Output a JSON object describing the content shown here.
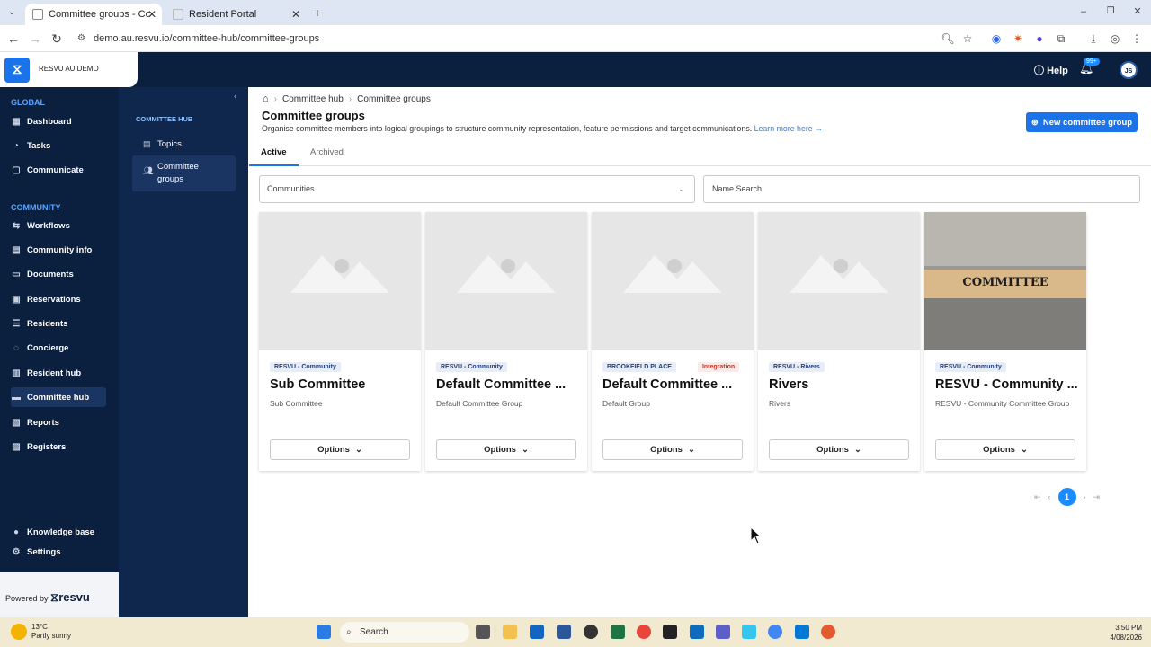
{
  "browser": {
    "tabs": [
      {
        "label": "Committee groups - Committe",
        "active": true
      },
      {
        "label": "Resident Portal",
        "active": false
      }
    ],
    "url": "demo.au.resvu.io/committee-hub/committee-groups"
  },
  "app": {
    "brand_name": "RESVU AU DEMO",
    "help_label": "Help",
    "notification_count": "99+",
    "user_initials": "JS"
  },
  "sidebar": {
    "global_label": "GLOBAL",
    "global_items": [
      {
        "label": "Dashboard",
        "icon": "dashboard-icon"
      },
      {
        "label": "Tasks",
        "icon": "tasks-icon"
      },
      {
        "label": "Communicate",
        "icon": "communicate-icon"
      }
    ],
    "community_label": "COMMUNITY",
    "community_items": [
      {
        "label": "Workflows",
        "icon": "workflows-icon"
      },
      {
        "label": "Community info",
        "icon": "info-icon"
      },
      {
        "label": "Documents",
        "icon": "documents-icon"
      },
      {
        "label": "Reservations",
        "icon": "reservations-icon"
      },
      {
        "label": "Residents",
        "icon": "residents-icon"
      },
      {
        "label": "Concierge",
        "icon": "concierge-icon"
      },
      {
        "label": "Resident hub",
        "icon": "resident-hub-icon"
      },
      {
        "label": "Committee hub",
        "icon": "committee-hub-icon",
        "active": true
      },
      {
        "label": "Reports",
        "icon": "reports-icon"
      },
      {
        "label": "Registers",
        "icon": "registers-icon"
      }
    ],
    "footer_items": [
      {
        "label": "Knowledge base",
        "icon": "knowledge-base-icon"
      },
      {
        "label": "Settings",
        "icon": "settings-icon"
      }
    ],
    "powered_by": "Powered by",
    "powered_brand": "resvu"
  },
  "subnav": {
    "section": "COMMITTEE HUB",
    "items": [
      {
        "label": "Topics",
        "icon": "topics-icon"
      },
      {
        "label": "Committee groups",
        "icon": "groups-icon",
        "active": true
      }
    ]
  },
  "page": {
    "breadcrumb": [
      "Committee hub",
      "Committee groups"
    ],
    "title": "Committee groups",
    "subtitle": "Organise committee members into logical groupings to structure community representation, feature permissions and target communications.",
    "learn_more": "Learn more here →",
    "new_button": "New committee group",
    "tabs": [
      "Active",
      "Archived"
    ],
    "communities_placeholder": "Communities",
    "search_placeholder": "Name Search"
  },
  "cards": [
    {
      "tags": [
        "RESVU - Community"
      ],
      "name": "Sub Committee",
      "desc": "Sub Committee",
      "options": "Options",
      "image": "placeholder"
    },
    {
      "tags": [
        "RESVU - Community"
      ],
      "name": "Default Committee ...",
      "desc": "Default Committee Group",
      "options": "Options",
      "image": "placeholder"
    },
    {
      "tags": [
        "BROOKFIELD PLACE",
        "Integration"
      ],
      "name": "Default Committee ...",
      "desc": "Default Group",
      "options": "Options",
      "image": "placeholder"
    },
    {
      "tags": [
        "RESVU - Rivers"
      ],
      "name": "Rivers",
      "desc": "Rivers",
      "options": "Options",
      "image": "placeholder"
    },
    {
      "tags": [
        "RESVU - Community"
      ],
      "name": "RESVU - Community ...",
      "desc": "RESVU - Community Committee Group",
      "options": "Options",
      "image": "committee-photo",
      "image_text": "COMMITTEE"
    }
  ],
  "pagination": {
    "current": "1"
  },
  "taskbar": {
    "temperature": "13°C",
    "weather": "Partly sunny",
    "search": "Search",
    "time": "3:50 PM",
    "date": "4/08/2026"
  },
  "colors": {
    "navy": "#0b1f3f",
    "accent": "#1a73e8",
    "tag_bg": "#e6ecf8",
    "integration": "#c0392b"
  }
}
